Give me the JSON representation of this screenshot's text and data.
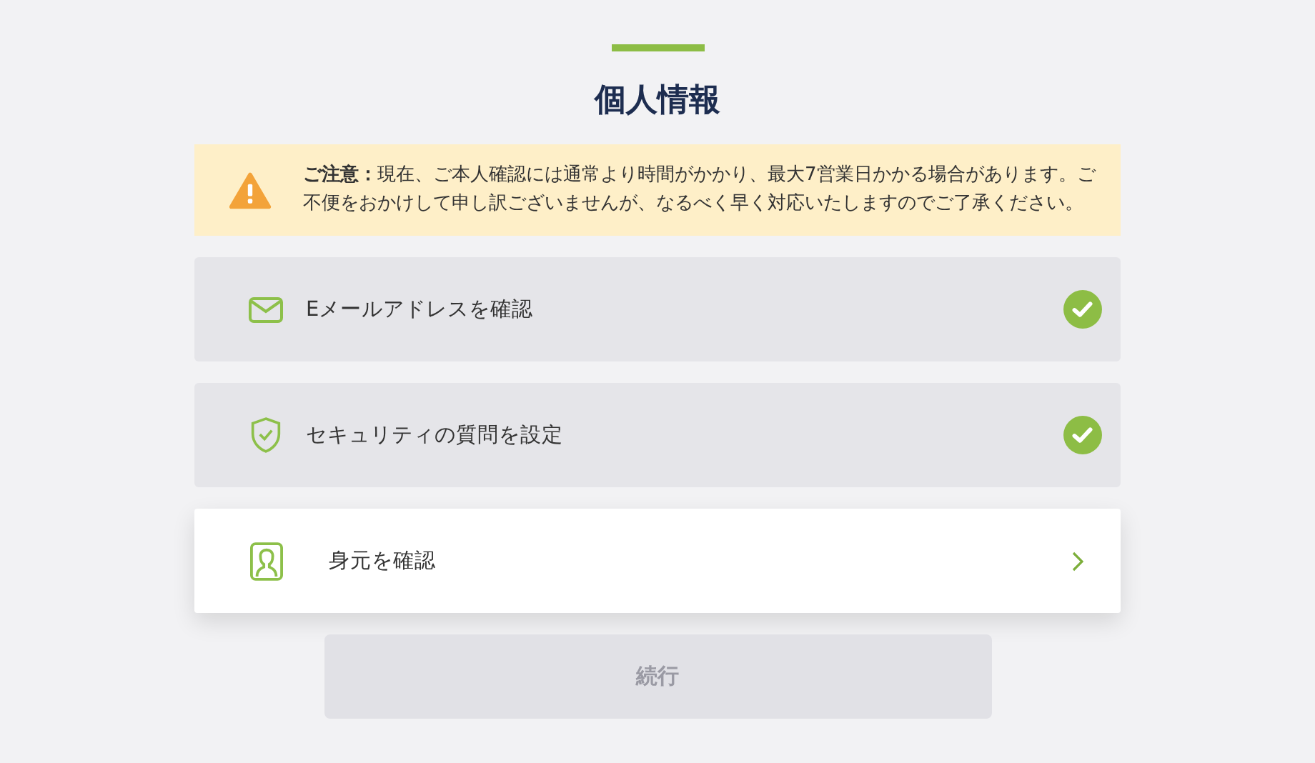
{
  "title": "個人情報",
  "notice": {
    "text": "**ご注意：**現在、ご本人確認には通常より時間がかかり、最大7営業日かかる場合があります。ご不便をおかけして申し訳ございませんが、なるべく早く対応いたしますのでご了承ください。"
  },
  "steps": [
    {
      "kind": "email",
      "label": "Eメールアドレスを確認",
      "completed": true
    },
    {
      "kind": "security",
      "label": "セキュリティの質問を設定",
      "completed": true
    },
    {
      "kind": "identity",
      "label": "身元を確認",
      "completed": false
    }
  ],
  "continue_button": {
    "label": "続行",
    "disabled": true
  }
}
